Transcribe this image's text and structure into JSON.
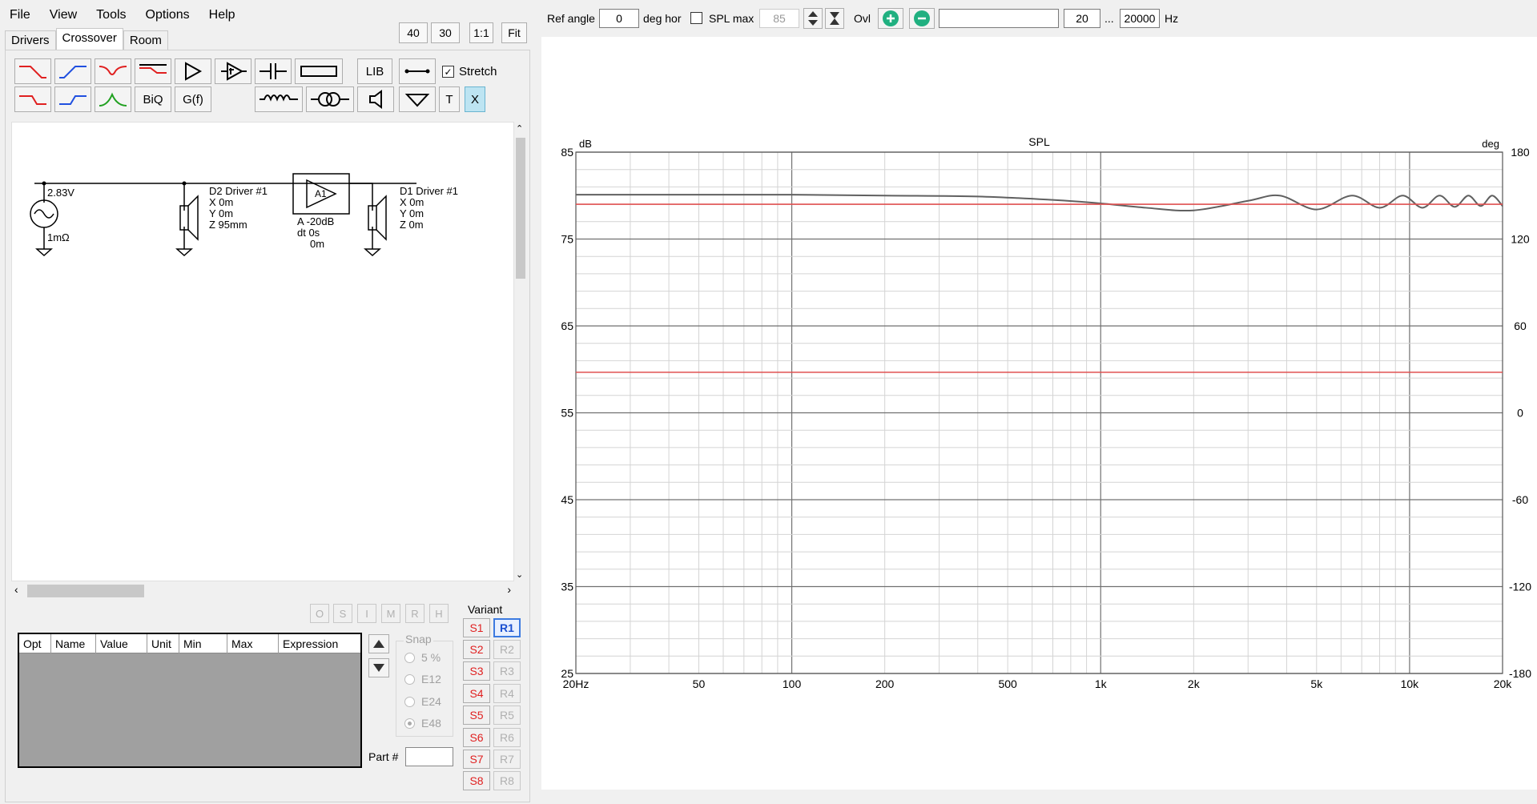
{
  "menu": [
    "File",
    "View",
    "Tools",
    "Options",
    "Help"
  ],
  "tabs": [
    "Drivers",
    "Crossover",
    "Room"
  ],
  "top_buttons": [
    "40",
    "30",
    "1:1",
    "Fit"
  ],
  "toolbar": {
    "lib_label": "LIB",
    "biq_label": "BiQ",
    "gf_label": "G(f)",
    "t_label": "T",
    "x_label": "X",
    "stretch_label": "Stretch",
    "stretch_checked": true
  },
  "schematic": {
    "source_voltage": "2.83V",
    "source_resistance": "1mΩ",
    "d2": {
      "name": "D2 Driver #1",
      "x": "X 0m",
      "y": "Y 0m",
      "z": "Z 95mm"
    },
    "amp": {
      "name": "A1",
      "gain": "A -20dB",
      "delay": "dt 0s",
      "dist": "0m"
    },
    "d1": {
      "name": "D1 Driver #1",
      "x": "X 0m",
      "y": "Y 0m",
      "z": "Z 0m"
    }
  },
  "opt_buttons": [
    "O",
    "S",
    "I",
    "M",
    "R",
    "H"
  ],
  "param_table": {
    "headers": [
      "Opt",
      "Name",
      "Value",
      "Unit",
      "Min",
      "Max",
      "Expression"
    ]
  },
  "snap": {
    "title": "Snap",
    "options": [
      "5 %",
      "E12",
      "E24",
      "E48"
    ],
    "selected": "E48"
  },
  "part_label": "Part #",
  "variant": {
    "title": "Variant",
    "s": [
      "S1",
      "S2",
      "S3",
      "S4",
      "S5",
      "S6",
      "S7",
      "S8"
    ],
    "r": [
      "R1",
      "R2",
      "R3",
      "R4",
      "R5",
      "R6",
      "R7",
      "R8"
    ],
    "active_r": "R1"
  },
  "top_controls": {
    "ref_angle_label": "Ref angle",
    "ref_angle_value": "0",
    "deg_hor_label": "deg hor",
    "spl_max_label": "SPL max",
    "spl_max_value": "85",
    "ovl_label": "Ovl",
    "freq_min": "20",
    "ellipsis": "...",
    "freq_max": "20000",
    "hz_label": "Hz"
  },
  "chart_data": {
    "type": "line",
    "title": "SPL",
    "ylabel_left": "dB",
    "ylabel_right": "deg",
    "x_scale": "log",
    "xlim": [
      20,
      20000
    ],
    "ylim": [
      25,
      85
    ],
    "y2lim": [
      -180,
      180
    ],
    "x_ticks": [
      "20Hz",
      "50",
      "100",
      "200",
      "500",
      "1k",
      "2k",
      "5k",
      "10k",
      "20k"
    ],
    "y_ticks": [
      "85",
      "75",
      "65",
      "55",
      "45",
      "35",
      "25"
    ],
    "y2_ticks": [
      "180",
      "120",
      "60",
      "0",
      "-60",
      "-120",
      "-180"
    ],
    "grid": true,
    "colors": {
      "spl": "#606060",
      "phase": "#e05050"
    },
    "series": [
      {
        "key": "spl",
        "x": [
          20,
          50,
          100,
          200,
          400,
          700,
          1000,
          1400,
          2000,
          3000,
          3800,
          5000,
          6500,
          8000,
          9500,
          11000,
          12500,
          14000,
          15500,
          17000,
          18500,
          20000
        ],
        "values": [
          80.1,
          80.1,
          80.1,
          80.0,
          79.9,
          79.5,
          79.1,
          78.6,
          78.3,
          79.4,
          80.0,
          78.4,
          80.0,
          78.6,
          80.0,
          78.6,
          80.0,
          78.7,
          80.0,
          78.8,
          80.0,
          78.8
        ]
      },
      {
        "key": "phase_1",
        "axis": "right",
        "x": [
          20,
          20000
        ],
        "values": [
          144,
          144
        ]
      },
      {
        "key": "phase_2",
        "axis": "right",
        "x": [
          20,
          20000
        ],
        "values": [
          28,
          28
        ]
      }
    ]
  }
}
